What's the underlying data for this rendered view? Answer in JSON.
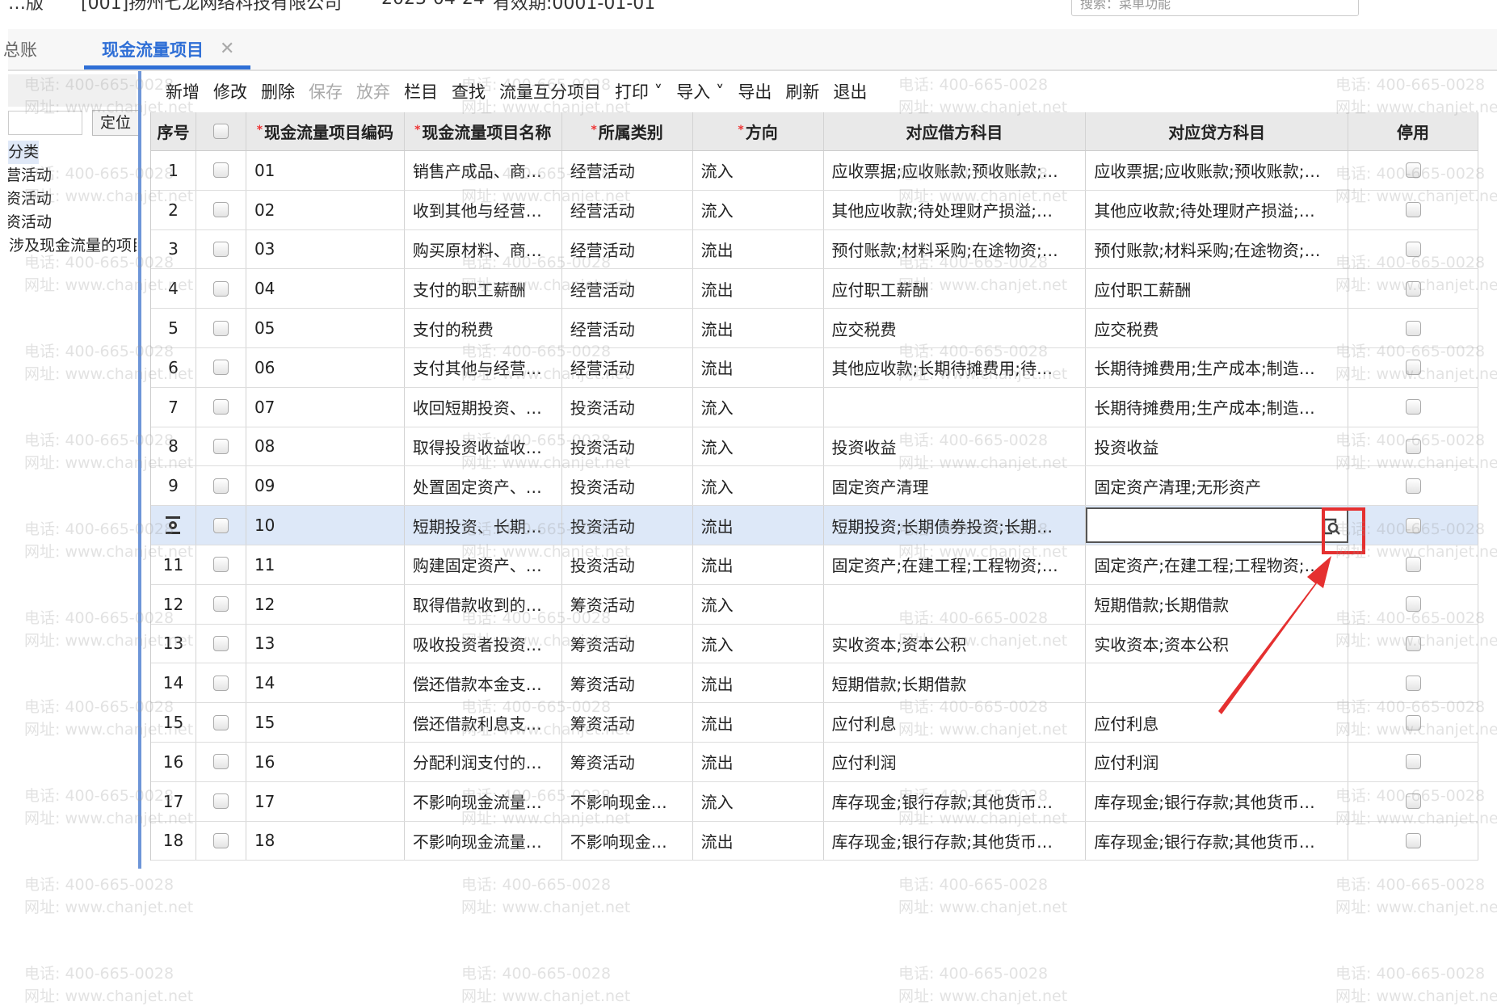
{
  "header": {
    "edition": "…版",
    "company": "[001]扬州七龙网络科技有限公司",
    "date": "2023-04-24",
    "valid": "有效期:0001-01-01",
    "search_placeholder": "搜索：菜单功能"
  },
  "tabs": {
    "prev": "总账",
    "active": "现金流量项目",
    "close": "✕"
  },
  "left": {
    "locate": "定位",
    "tree": [
      "项目分类",
      "经营活动",
      "投资活动",
      "筹资活动",
      "不涉及现金流量的项目"
    ]
  },
  "toolbar": [
    {
      "label": "新增",
      "enabled": true
    },
    {
      "label": "修改",
      "enabled": true
    },
    {
      "label": "删除",
      "enabled": true
    },
    {
      "label": "保存",
      "enabled": false
    },
    {
      "label": "放弃",
      "enabled": false
    },
    {
      "label": "栏目",
      "enabled": true
    },
    {
      "label": "查找",
      "enabled": true
    },
    {
      "label": "流量互分项目",
      "enabled": true
    },
    {
      "label": "打印 ˅",
      "enabled": true
    },
    {
      "label": "导入 ˅",
      "enabled": true
    },
    {
      "label": "导出",
      "enabled": true
    },
    {
      "label": "刷新",
      "enabled": true
    },
    {
      "label": "退出",
      "enabled": true
    }
  ],
  "columns": [
    "序号",
    "",
    "现金流量项目编码",
    "现金流量项目名称",
    "所属类别",
    "方向",
    "对应借方科目",
    "对应贷方科目",
    "停用"
  ],
  "required_mark": "*",
  "rows": [
    [
      "1",
      "01",
      "销售产成品、商…",
      "经营活动",
      "流入",
      "应收票据;应收账款;预收账款;…",
      "应收票据;应收账款;预收账款;…"
    ],
    [
      "2",
      "02",
      "收到其他与经营…",
      "经营活动",
      "流入",
      "其他应收款;待处理财产损溢;…",
      "其他应收款;待处理财产损溢;…"
    ],
    [
      "3",
      "03",
      "购买原材料、商…",
      "经营活动",
      "流出",
      "预付账款;材料采购;在途物资;…",
      "预付账款;材料采购;在途物资;…"
    ],
    [
      "4",
      "04",
      "支付的职工薪酬",
      "经营活动",
      "流出",
      "应付职工薪酬",
      "应付职工薪酬"
    ],
    [
      "5",
      "05",
      "支付的税费",
      "经营活动",
      "流出",
      "应交税费",
      "应交税费"
    ],
    [
      "6",
      "06",
      "支付其他与经营…",
      "经营活动",
      "流出",
      "其他应收款;长期待摊费用;待…",
      "长期待摊费用;生产成本;制造…"
    ],
    [
      "7",
      "07",
      "收回短期投资、…",
      "投资活动",
      "流入",
      "",
      "长期待摊费用;生产成本;制造…"
    ],
    [
      "8",
      "08",
      "取得投资收益收…",
      "投资活动",
      "流入",
      "投资收益",
      "投资收益"
    ],
    [
      "9",
      "09",
      "处置固定资产、…",
      "投资活动",
      "流入",
      "固定资产清理",
      "固定资产清理;无形资产"
    ],
    [
      "10",
      "10",
      "短期投资、长期…",
      "投资活动",
      "流出",
      "短期投资;长期债券投资;长期…",
      ""
    ],
    [
      "11",
      "11",
      "购建固定资产、…",
      "投资活动",
      "流出",
      "固定资产;在建工程;工程物资;…",
      "固定资产;在建工程;工程物资;…"
    ],
    [
      "12",
      "12",
      "取得借款收到的…",
      "筹资活动",
      "流入",
      "",
      "短期借款;长期借款"
    ],
    [
      "13",
      "13",
      "吸收投资者投资…",
      "筹资活动",
      "流入",
      "实收资本;资本公积",
      "实收资本;资本公积"
    ],
    [
      "14",
      "14",
      "偿还借款本金支…",
      "筹资活动",
      "流出",
      "短期借款;长期借款",
      ""
    ],
    [
      "15",
      "15",
      "偿还借款利息支…",
      "筹资活动",
      "流出",
      "应付利息",
      "应付利息"
    ],
    [
      "16",
      "16",
      "分配利润支付的…",
      "筹资活动",
      "流出",
      "应付利润",
      "应付利润"
    ],
    [
      "17",
      "17",
      "不影响现金流量…",
      "不影响现金…",
      "流入",
      "库存现金;银行存款;其他货币…",
      "库存现金;银行存款;其他货币…"
    ],
    [
      "18",
      "18",
      "不影响现金流量…",
      "不影响现金…",
      "流出",
      "库存现金;银行存款;其他货币…",
      "库存现金;银行存款;其他货币…"
    ]
  ],
  "selected_row": 10,
  "watermark": {
    "phone": "电话: 400-665-0028",
    "site": "网址: www.chanjet.net"
  },
  "colors": {
    "accent": "#2f6fd6",
    "annotation": "#e53030",
    "selected": "#dde8f8"
  }
}
